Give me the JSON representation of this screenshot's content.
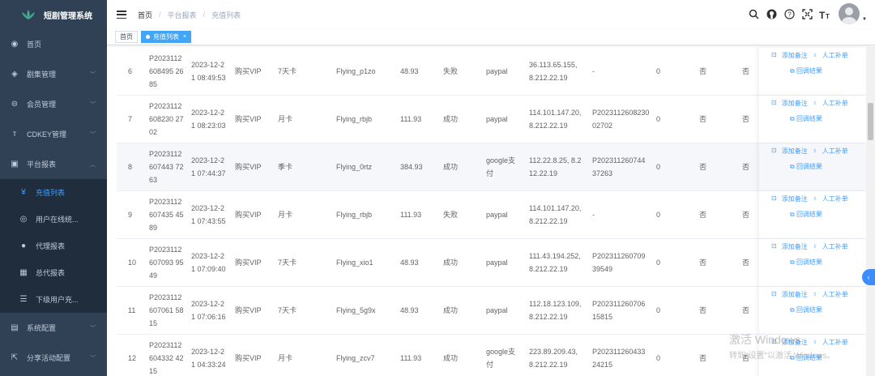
{
  "app": {
    "title": "短剧管理系统"
  },
  "sidebar": {
    "items": [
      {
        "label": "首页",
        "icon": "dashboard-icon"
      },
      {
        "label": "剧集管理",
        "icon": "layers-icon"
      },
      {
        "label": "会员管理",
        "icon": "vip-icon"
      },
      {
        "label": "CDKEY管理",
        "icon": "text-size-icon"
      },
      {
        "label": "平台报表",
        "icon": "report-icon"
      }
    ],
    "submenu": [
      {
        "label": "充值列表",
        "icon": "yen-icon",
        "active": true
      },
      {
        "label": "用户在线统...",
        "icon": "online-icon"
      },
      {
        "label": "代理报表",
        "icon": "user-icon"
      },
      {
        "label": "总代报表",
        "icon": "table-icon"
      },
      {
        "label": "下级用户充...",
        "icon": "list-icon"
      }
    ],
    "bottom": [
      {
        "label": "系统配置",
        "icon": "settings-icon"
      },
      {
        "label": "分享活动配置",
        "icon": "share-icon"
      }
    ]
  },
  "header": {
    "breadcrumb": [
      "首页",
      "平台报表",
      "充值列表"
    ]
  },
  "tags": [
    {
      "label": "首页",
      "active": false
    },
    {
      "label": "充值列表",
      "active": true
    }
  ],
  "actions": {
    "remark": "添加备注",
    "manual": "人工补单",
    "callback": "回调结果"
  },
  "rows": [
    {
      "idx": "6",
      "order": "P2023112608495 2685",
      "time": "2023-12-21 08:49:53",
      "type": "购买VIP",
      "item": "7天卡",
      "user": "Flying_p1zo",
      "amount": "48.93",
      "status": "失败",
      "pay": "paypal",
      "ip": "36.113.65.155, 8.212.22.19",
      "ext": "-",
      "n": "0",
      "f1": "否",
      "f2": "否",
      "hl": false
    },
    {
      "idx": "7",
      "order": "P2023112608230 2702",
      "time": "2023-12-21 08:23:03",
      "type": "购买VIP",
      "item": "月卡",
      "user": "Flying_rbjb",
      "amount": "111.93",
      "status": "成功",
      "pay": "paypal",
      "ip": "114.101.147.20, 8.212.22.19",
      "ext": "P202311260823002702",
      "n": "0",
      "f1": "否",
      "f2": "否",
      "hl": false
    },
    {
      "idx": "8",
      "order": "P2023112607443 7263",
      "time": "2023-12-21 07:44:37",
      "type": "购买VIP",
      "item": "季卡",
      "user": "Flying_0rtz",
      "amount": "384.93",
      "status": "成功",
      "pay": "google支付",
      "ip": "112.22.8.25, 8.212.22.19",
      "ext": "P202311260744 37263",
      "n": "0",
      "f1": "否",
      "f2": "否",
      "hl": true
    },
    {
      "idx": "9",
      "order": "P2023112607435 4589",
      "time": "2023-12-21 07:43:55",
      "type": "购买VIP",
      "item": "月卡",
      "user": "Flying_rbjb",
      "amount": "111.93",
      "status": "失败",
      "pay": "paypal",
      "ip": "114.101.147.20, 8.212.22.19",
      "ext": "-",
      "n": "0",
      "f1": "否",
      "f2": "否",
      "hl": false
    },
    {
      "idx": "10",
      "order": "P2023112607093 9549",
      "time": "2023-12-21 07:09:40",
      "type": "购买VIP",
      "item": "7天卡",
      "user": "Flying_xio1",
      "amount": "48.93",
      "status": "成功",
      "pay": "paypal",
      "ip": "111.43.194.252, 8.212.22.19",
      "ext": "P202311260709 39549",
      "n": "0",
      "f1": "否",
      "f2": "否",
      "hl": false
    },
    {
      "idx": "11",
      "order": "P2023112607061 5815",
      "time": "2023-12-21 07:06:16",
      "type": "购买VIP",
      "item": "7天卡",
      "user": "Flying_5g9x",
      "amount": "48.93",
      "status": "成功",
      "pay": "paypal",
      "ip": "112.18.123.109, 8.212.22.19",
      "ext": "P202311260706 15815",
      "n": "0",
      "f1": "否",
      "f2": "否",
      "hl": false
    },
    {
      "idx": "12",
      "order": "P2023112604332 4215",
      "time": "2023-12-21 04:33:24",
      "type": "购买VIP",
      "item": "月卡",
      "user": "Flying_zcv7",
      "amount": "111.93",
      "status": "成功",
      "pay": "google支付",
      "ip": "223.89.209.43, 8.212.22.19",
      "ext": "P202311260433 24215",
      "n": "0",
      "f1": "否",
      "f2": "否",
      "hl": false
    }
  ],
  "watermark": {
    "line1": "激活 Windows",
    "line2": "转到\"设置\"以激活 Windows。"
  }
}
